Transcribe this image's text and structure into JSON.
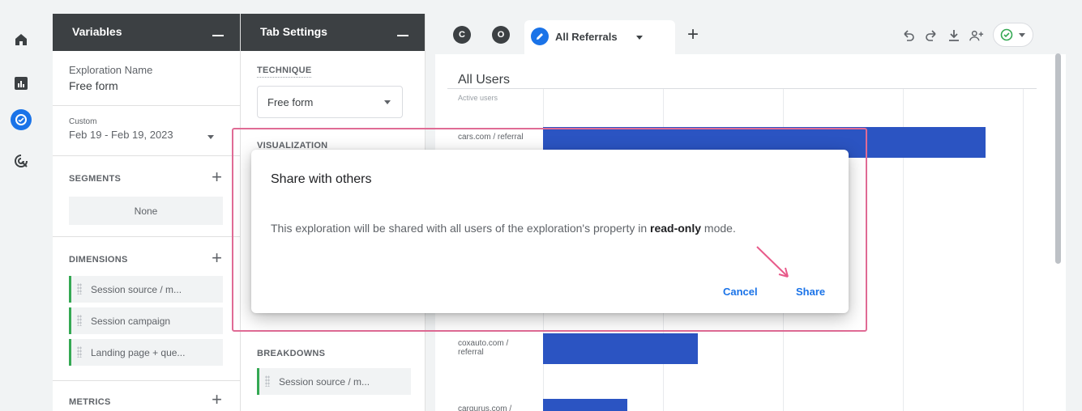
{
  "nav_rail": {
    "icons": [
      "home-icon",
      "reports-icon",
      "explore-icon",
      "advertising-icon"
    ],
    "active": "explore-icon"
  },
  "variables_panel": {
    "title": "Variables",
    "exploration_name_label": "Exploration Name",
    "exploration_name_value": "Free form",
    "date_caption": "Custom",
    "date_range": "Feb 19 - Feb 19, 2023",
    "segments_title": "SEGMENTS",
    "segments_empty": "None",
    "dimensions_title": "DIMENSIONS",
    "dimensions": [
      "Session source / m...",
      "Session campaign",
      "Landing page + que..."
    ],
    "metrics_title": "METRICS"
  },
  "tab_settings_panel": {
    "title": "Tab Settings",
    "technique_title": "TECHNIQUE",
    "technique_value": "Free form",
    "visualization_title": "VISUALIZATION",
    "breakdowns_title": "BREAKDOWNS",
    "breakdown_item": "Session source / m..."
  },
  "tabs": {
    "circle_1": "C",
    "circle_2": "O",
    "active_tab": "All Referrals",
    "add": "+"
  },
  "toolbar": {
    "icons": [
      "undo-icon",
      "redo-icon",
      "download-icon",
      "share-icon",
      "status-check-icon"
    ]
  },
  "chart": {
    "title": "All Users",
    "subtitle": "Active users",
    "rows": [
      {
        "label": "cars.com / referral",
        "value": 1.0
      },
      {
        "label": "coxauto.com / referral",
        "value": 0.35
      },
      {
        "label": "cargurus.com /",
        "value": 0.19
      }
    ]
  },
  "dialog": {
    "title": "Share with others",
    "body_pre": "This exploration will be shared with all users of the exploration's property in ",
    "body_bold": "read-only",
    "body_post": " mode.",
    "cancel": "Cancel",
    "share": "Share"
  },
  "colors": {
    "accent": "#1a73e8",
    "bar": "#2b54c2",
    "highlight": "#e06b95",
    "panel_header": "#3c4043"
  }
}
